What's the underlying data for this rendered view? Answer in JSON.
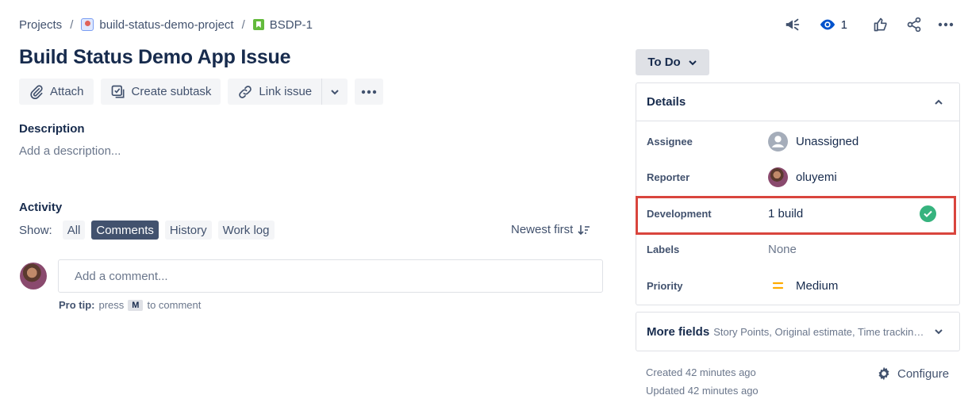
{
  "breadcrumb": {
    "projects": "Projects",
    "separator": "/",
    "project": "build-status-demo-project",
    "project_icon": "project-avatar-icon",
    "issue_key": "BSDP-1",
    "issue_icon": "story-icon"
  },
  "header_actions": {
    "feedback_icon": "megaphone-icon",
    "watch_icon": "eye-icon",
    "watch_count": "1",
    "vote_icon": "thumbs-up-icon",
    "share_icon": "share-icon",
    "more_icon": "more-icon"
  },
  "issue": {
    "title": "Build Status Demo App Issue"
  },
  "toolbar": {
    "attach_label": "Attach",
    "create_subtask_label": "Create subtask",
    "link_issue_label": "Link issue"
  },
  "description": {
    "heading": "Description",
    "placeholder": "Add a description..."
  },
  "activity": {
    "heading": "Activity",
    "show_label": "Show:",
    "filters": [
      "All",
      "Comments",
      "History",
      "Work log"
    ],
    "active_filter": "Comments",
    "sort_label": "Newest first",
    "comment_placeholder": "Add a comment...",
    "protip_bold": "Pro tip:",
    "protip_press": "press",
    "protip_key": "M",
    "protip_suffix": "to comment"
  },
  "status": {
    "label": "To Do"
  },
  "details": {
    "heading": "Details",
    "fields": [
      {
        "label": "Assignee",
        "value": "Unassigned"
      },
      {
        "label": "Reporter",
        "value": "oluyemi"
      },
      {
        "label": "Development",
        "value": "1 build"
      },
      {
        "label": "Labels",
        "value": "None"
      },
      {
        "label": "Priority",
        "value": "Medium"
      }
    ]
  },
  "more_fields": {
    "title": "More fields",
    "subtitle": "Story Points, Original estimate, Time tracking, Components, Sprint, Fix versions"
  },
  "meta": {
    "created": "Created 42 minutes ago",
    "updated": "Updated 42 minutes ago",
    "configure_label": "Configure"
  },
  "colors": {
    "accent_dark": "#42526e",
    "highlight_border": "#d9453d",
    "build_success": "#36b37e",
    "priority_medium": "#ffab00"
  }
}
